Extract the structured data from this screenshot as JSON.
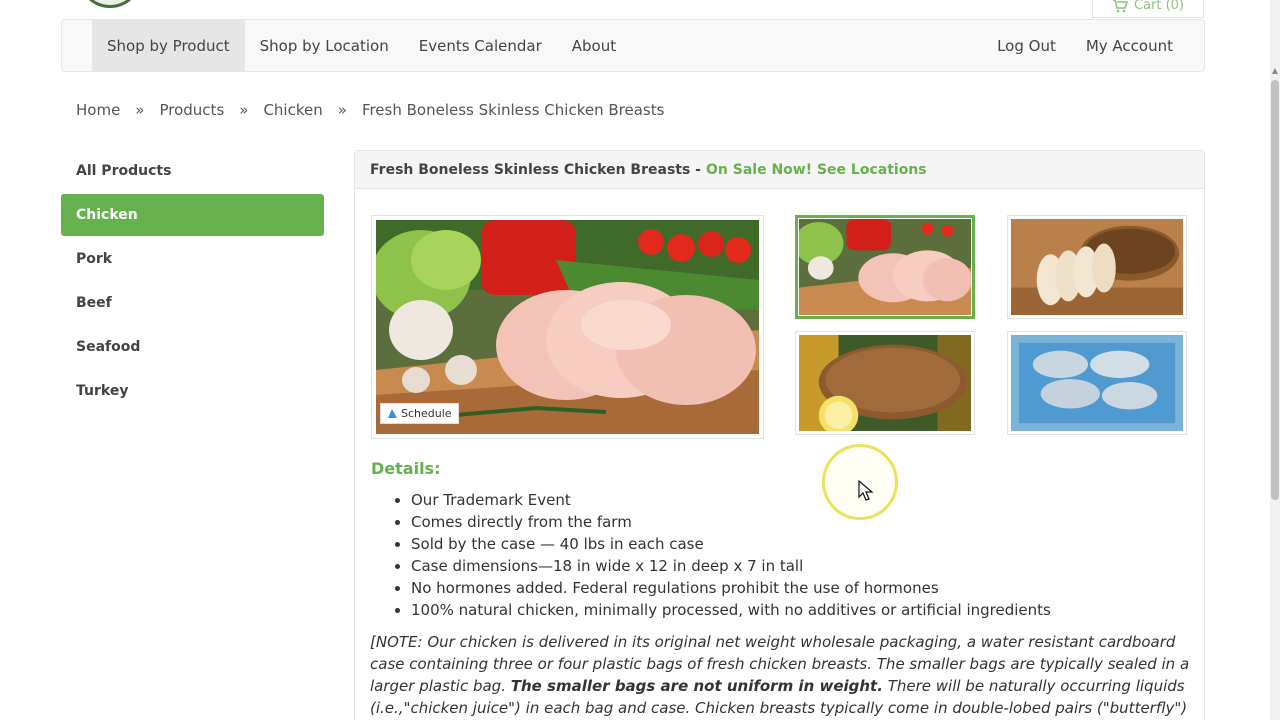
{
  "header": {
    "cart_label": "Cart (0)"
  },
  "nav": {
    "left": [
      "Shop by Product",
      "Shop by Location",
      "Events Calendar",
      "About"
    ],
    "right": [
      "Log Out",
      "My Account"
    ],
    "active": "Shop by Product"
  },
  "breadcrumb": {
    "items": [
      "Home",
      "Products",
      "Chicken",
      "Fresh Boneless Skinless Chicken Breasts"
    ],
    "separator": "»"
  },
  "sidebar": {
    "items": [
      "All Products",
      "Chicken",
      "Pork",
      "Beef",
      "Seafood",
      "Turkey"
    ],
    "active": "Chicken"
  },
  "product": {
    "title": "Fresh Boneless Skinless Chicken Breasts -",
    "sale_link": "On Sale Now! See Locations",
    "schedule_label": "Schedule",
    "details_title": "Details:",
    "details": [
      "Our Trademark Event",
      "Comes directly from the farm",
      "Sold by the case — 40 lbs in each case",
      "Case dimensions—18 in wide x 12 in deep x 7 in tall",
      "No hormones added. Federal regulations prohibit the use of hormones",
      "100% natural chicken, minimally processed, with no additives or artificial ingredients"
    ],
    "note_part1": "[NOTE:  Our chicken is delivered in its original net weight wholesale packaging, a water resistant cardboard case containing three or four plastic bags of fresh chicken breasts. The smaller bags are typically sealed in a larger plastic bag. ",
    "note_bold": "The smaller bags are not uniform in weight.",
    "note_part2": " There will be naturally occurring liquids (i.e.,\"chicken juice\") in each bag and case. Chicken breasts typically come in double-lobed pairs (\"butterfly\") and will have"
  },
  "colors": {
    "accent": "#67b04e",
    "nav_bg": "#f8f8f8"
  }
}
